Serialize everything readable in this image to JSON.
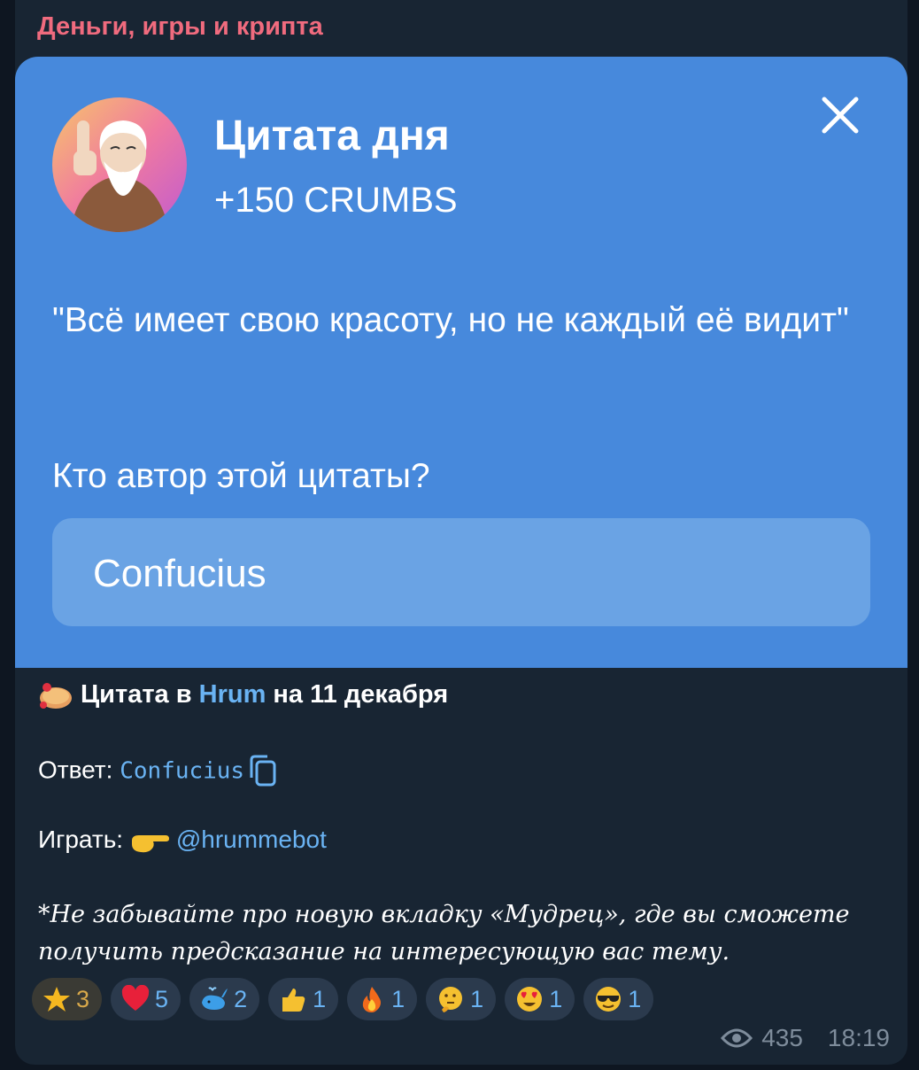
{
  "channel_name": "Деньги, игры и крипта",
  "card": {
    "title": "Цитата дня",
    "reward": "+150 CRUMBS",
    "quote": "\"Всё имеет свою красоту, но не каждый её видит\"",
    "question": "Кто автор этой цитаты?",
    "answer": "Confucius"
  },
  "body": {
    "line1_prefix": "Цитата в ",
    "line1_link": "Hrum",
    "line1_suffix": " на 11 декабря",
    "answer_label": "Ответ: ",
    "answer_value": "Confucius",
    "play_label": "Играть: ",
    "play_link": "@hrummebot",
    "note": "*Не забывайте про новую вкладку «Мудрец», где вы сможете получить предсказание на интересующую вас тему."
  },
  "reactions": [
    {
      "icon": "star-icon",
      "count": "3",
      "active": true
    },
    {
      "icon": "heart-icon",
      "count": "5"
    },
    {
      "icon": "whale-icon",
      "count": "2"
    },
    {
      "icon": "thumbs-up-icon",
      "count": "1"
    },
    {
      "icon": "fire-icon",
      "count": "1"
    },
    {
      "icon": "thinking-face-icon",
      "count": "1"
    },
    {
      "icon": "heart-eyes-icon",
      "count": "1"
    },
    {
      "icon": "sunglasses-face-icon",
      "count": "1"
    }
  ],
  "meta": {
    "views": "435",
    "time": "18:19"
  },
  "colors": {
    "card": "#4789dc",
    "answer_box": "#6aa3e4",
    "background": "#182533",
    "channel": "#f06b7e",
    "link": "#6ab3f3"
  }
}
